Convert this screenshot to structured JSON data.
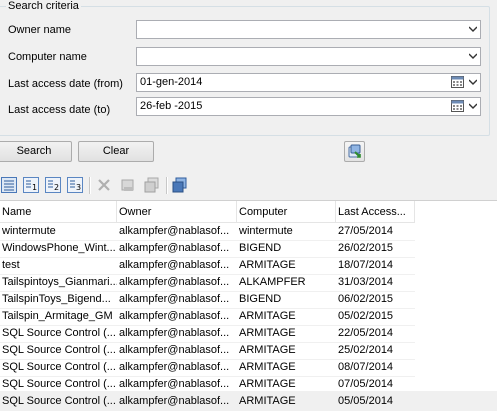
{
  "search_criteria": {
    "legend": "Search criteria",
    "fields": [
      {
        "label": "Owner name",
        "value": ""
      },
      {
        "label": "Computer name",
        "value": ""
      },
      {
        "label": "Last access date (from)",
        "value": "01-gen-2014"
      },
      {
        "label": "Last access date (to)",
        "value": "26-feb -2015"
      }
    ]
  },
  "buttons": {
    "search": "Search",
    "clear": "Clear",
    "export_icon": "export-icon"
  },
  "toolbar": {
    "icons": [
      "view-details-icon",
      "sort-1-icon",
      "sort-2-icon",
      "sort-3-icon",
      "delete-icon",
      "edit-icon",
      "copy-icon",
      "database-icon"
    ]
  },
  "grid": {
    "columns": [
      "Name",
      "Owner",
      "Computer",
      "Last Access..."
    ],
    "rows": [
      [
        "wintermute",
        "alkampfer@nablasof...",
        "wintermute",
        "27/05/2014"
      ],
      [
        "WindowsPhone_Wint...",
        "alkampfer@nablasof...",
        "BIGEND",
        "26/02/2015"
      ],
      [
        "test",
        "alkampfer@nablasof...",
        "ARMITAGE",
        "18/07/2014"
      ],
      [
        "Tailspintoys_Gianmari...",
        "alkampfer@nablasof...",
        "ALKAMPFER",
        "31/03/2014"
      ],
      [
        "TailspinToys_Bigend...",
        "alkampfer@nablasof...",
        "BIGEND",
        "06/02/2015"
      ],
      [
        "Tailspin_Armitage_GM",
        "alkampfer@nablasof...",
        "ARMITAGE",
        "05/02/2015"
      ],
      [
        "SQL Source Control  (...",
        "alkampfer@nablasof...",
        "ARMITAGE",
        "22/05/2014"
      ],
      [
        "SQL Source Control  (...",
        "alkampfer@nablasof...",
        "ARMITAGE",
        "25/02/2014"
      ],
      [
        "SQL Source Control  (...",
        "alkampfer@nablasof...",
        "ARMITAGE",
        "08/07/2014"
      ],
      [
        "SQL Source Control  (...",
        "alkampfer@nablasof...",
        "ARMITAGE",
        "07/05/2014"
      ],
      [
        "SQL Source Control  (...",
        "alkampfer@nablasof...",
        "ARMITAGE",
        "05/05/2014"
      ]
    ]
  }
}
